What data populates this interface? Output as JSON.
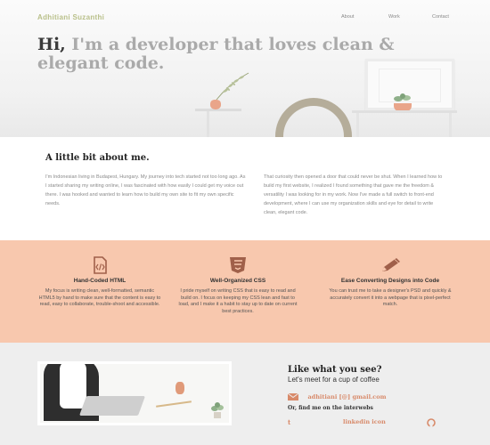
{
  "header": {
    "brand": "Adhitiani Suzanthi",
    "nav": [
      "About",
      "Work",
      "Contact"
    ]
  },
  "hero": {
    "title_hi": "Hi,",
    "title_rest": " I'm a developer that loves clean & elegant code."
  },
  "about": {
    "heading": "A little bit about me.",
    "col1": "I'm Indonesian living in Budapest, Hungary. My journey into tech started not too long ago. As I started sharing my writing online, I was fascinated with how easily I could get my voice out there. I was hooked and wanted to learn how to build my own site to fit my own specific needs.",
    "col2": "That curiosity then opened a door that could never be shut. When I learned how to build my first website, I realized I found something that gave me the freedom & versatility I was looking for in my work. Now I've made a full switch to front-end development, where I can use my organization skills and eye for detail to write clean, elegant code."
  },
  "skills": [
    {
      "icon": "code-file-icon",
      "title": "Hand-Coded HTML",
      "text": "My focus is writing clean, well-formatted, semantic HTML5 by hand to make sure that the content is easy to read, easy to collaborate, trouble-shoot and accessible."
    },
    {
      "icon": "css3-icon",
      "title": "Well-Organized CSS",
      "text": "I pride myself on writing CSS that is easy to read and build on. I focus on keeping my CSS lean and fast to load, and I make it a habit to stay up to date on current best practices."
    },
    {
      "icon": "pencil-icon",
      "title": "Ease Converting Designs into Code",
      "text": "You can trust me to take a designer's PSD and quickly & accurately convert it into a webpage that is pixel-perfect match."
    }
  ],
  "contact": {
    "heading": "Like what you see?",
    "subheading": "Let's meet for a cup of coffee",
    "email": "adhitiani [@] gmail.com",
    "find": "Or, find me on the interwebs",
    "tumblr": "t",
    "linkedin": "linkedin icon"
  },
  "colors": {
    "accent": "#d88a6a",
    "peach": "#f8c8ae",
    "brand": "#b9c08a"
  }
}
